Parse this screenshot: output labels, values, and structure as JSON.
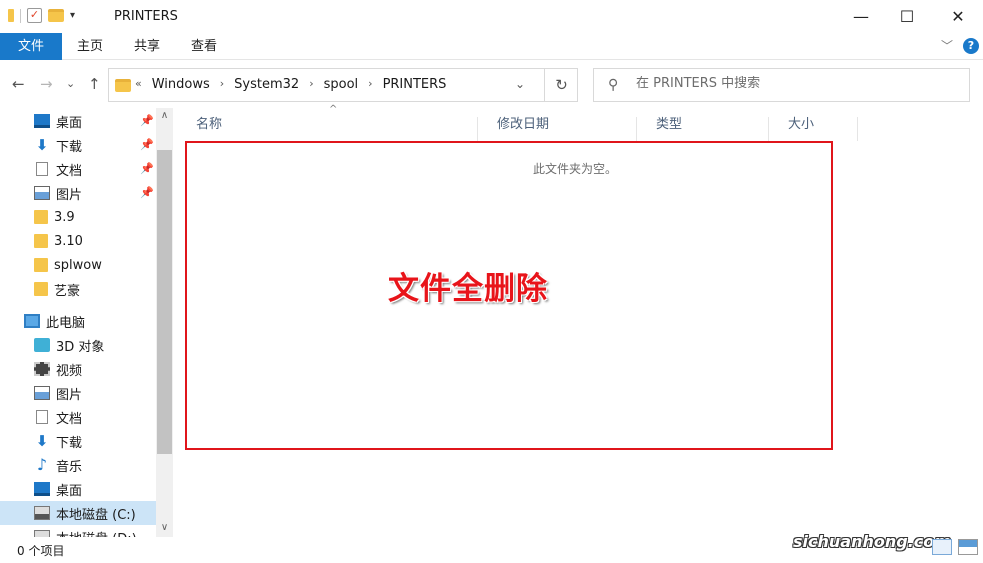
{
  "window": {
    "title": "PRINTERS",
    "controls": {
      "minimize": "—",
      "maximize": "☐",
      "close": "✕"
    }
  },
  "ribbon": {
    "tabs": [
      "文件",
      "主页",
      "共享",
      "查看"
    ],
    "help": "?"
  },
  "navigation": {
    "back": "←",
    "forward": "→",
    "dropdown": "⌄",
    "up": "↑",
    "breadcrumb_prefix": "«",
    "breadcrumb": [
      "Windows",
      "System32",
      "spool",
      "PRINTERS"
    ],
    "refresh": "↻"
  },
  "search": {
    "placeholder": "在 PRINTERS 中搜索"
  },
  "sidebar": {
    "quick_access": [
      {
        "label": "桌面",
        "icon": "desktop-icon",
        "pinned": true
      },
      {
        "label": "下载",
        "icon": "download-icon",
        "pinned": true
      },
      {
        "label": "文档",
        "icon": "document-icon",
        "pinned": true
      },
      {
        "label": "图片",
        "icon": "pictures-icon",
        "pinned": true
      },
      {
        "label": "3.9",
        "icon": "folder-icon",
        "pinned": false
      },
      {
        "label": "3.10",
        "icon": "folder-icon",
        "pinned": false
      },
      {
        "label": "splwow",
        "icon": "folder-icon",
        "pinned": false
      },
      {
        "label": "艺豪",
        "icon": "folder-icon",
        "pinned": false
      }
    ],
    "this_pc": {
      "label": "此电脑",
      "icon": "computer-icon"
    },
    "pc_items": [
      {
        "label": "3D 对象",
        "icon": "3d-objects-icon"
      },
      {
        "label": "视频",
        "icon": "video-icon"
      },
      {
        "label": "图片",
        "icon": "pictures-icon"
      },
      {
        "label": "文档",
        "icon": "document-icon"
      },
      {
        "label": "下载",
        "icon": "download-icon"
      },
      {
        "label": "音乐",
        "icon": "music-icon"
      },
      {
        "label": "桌面",
        "icon": "desktop-icon"
      },
      {
        "label": "本地磁盘 (C:)",
        "icon": "drive-icon",
        "selected": true
      },
      {
        "label": "本地磁盘 (D:)",
        "icon": "drive-icon"
      }
    ],
    "pin_glyph": "📌"
  },
  "columns": [
    "名称",
    "修改日期",
    "类型",
    "大小"
  ],
  "content": {
    "empty_message": "此文件夹为空。",
    "annotation": "文件全删除"
  },
  "status_bar": {
    "item_count": "0 个项目"
  },
  "watermark": "sichuanhong.com",
  "colors": {
    "accent": "#1979ca",
    "annotation_red": "#e8141a",
    "selection": "#cce4f7"
  }
}
